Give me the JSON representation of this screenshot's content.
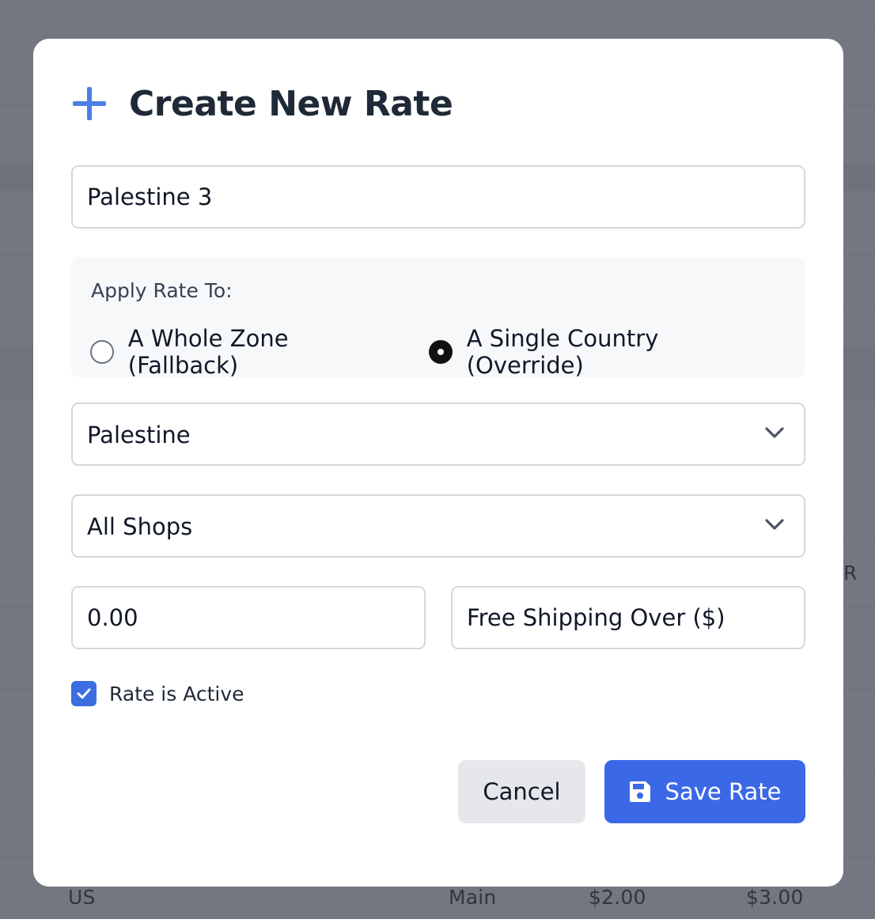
{
  "background": {
    "row_partial_letter": "R",
    "row": {
      "country": "US",
      "shop": "Main",
      "rate": "$2.00",
      "free_over": "$3.00"
    }
  },
  "modal": {
    "title": "Create New Rate",
    "title_icon": "plus-icon",
    "rate_name": {
      "value": "Palestine 3"
    },
    "apply_rate": {
      "label": "Apply Rate To:",
      "options": [
        {
          "label": "A Whole Zone (Fallback)",
          "checked": false
        },
        {
          "label": "A Single Country (Override)",
          "checked": true
        }
      ]
    },
    "country_select": {
      "value": "Palestine"
    },
    "shop_select": {
      "value": "All Shops"
    },
    "rate_amount": {
      "value": "0.00"
    },
    "free_shipping": {
      "placeholder": "Free Shipping Over ($)"
    },
    "active": {
      "label": "Rate is Active",
      "checked": true
    },
    "buttons": {
      "cancel": "Cancel",
      "save": "Save Rate",
      "save_icon": "save-icon"
    }
  },
  "colors": {
    "accent": "#3b68e6",
    "overlay": "#737780",
    "plus_icon": "#4a7fe5"
  }
}
